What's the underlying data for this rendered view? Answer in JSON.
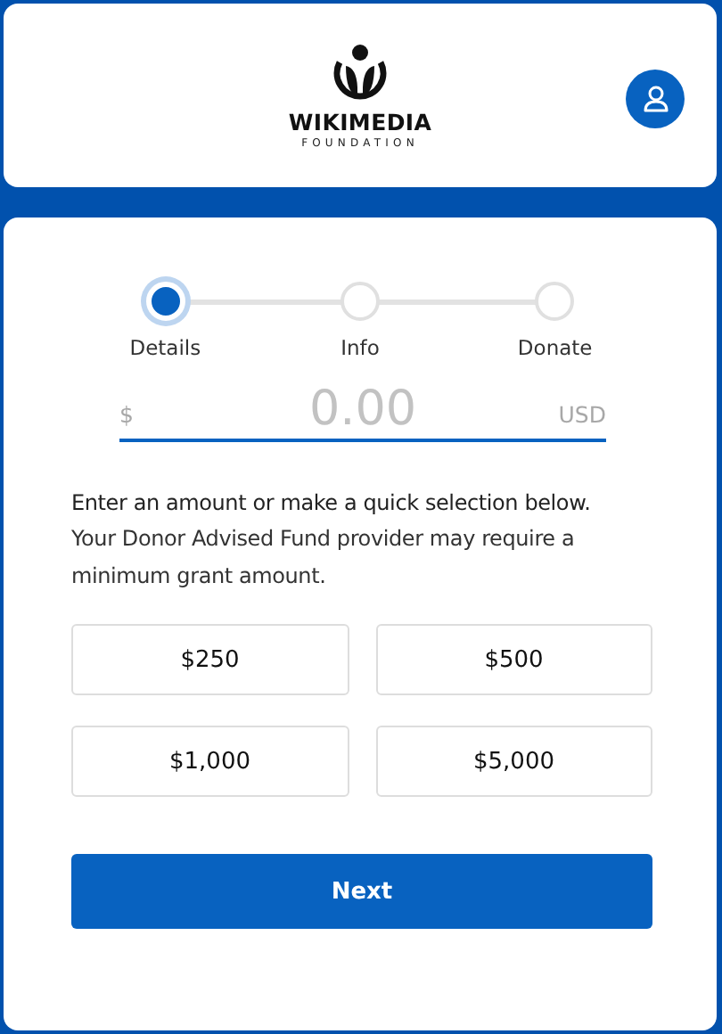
{
  "header": {
    "logo": {
      "name": "WIKIMEDIA",
      "subtitle": "FOUNDATION"
    }
  },
  "steps": [
    {
      "label": "Details",
      "selected": true
    },
    {
      "label": "Info",
      "selected": false
    },
    {
      "label": "Donate",
      "selected": false
    }
  ],
  "amount": {
    "prefix": "$",
    "placeholder": "0.00",
    "currency": "USD"
  },
  "instructions": {
    "lead": "Enter an amount or make a quick selection below.",
    "note": "Your Donor Advised Fund provider may require a minimum grant amount."
  },
  "quick_amounts": [
    "$250",
    "$500",
    "$1,000",
    "$5,000"
  ],
  "next_button": "Next"
}
